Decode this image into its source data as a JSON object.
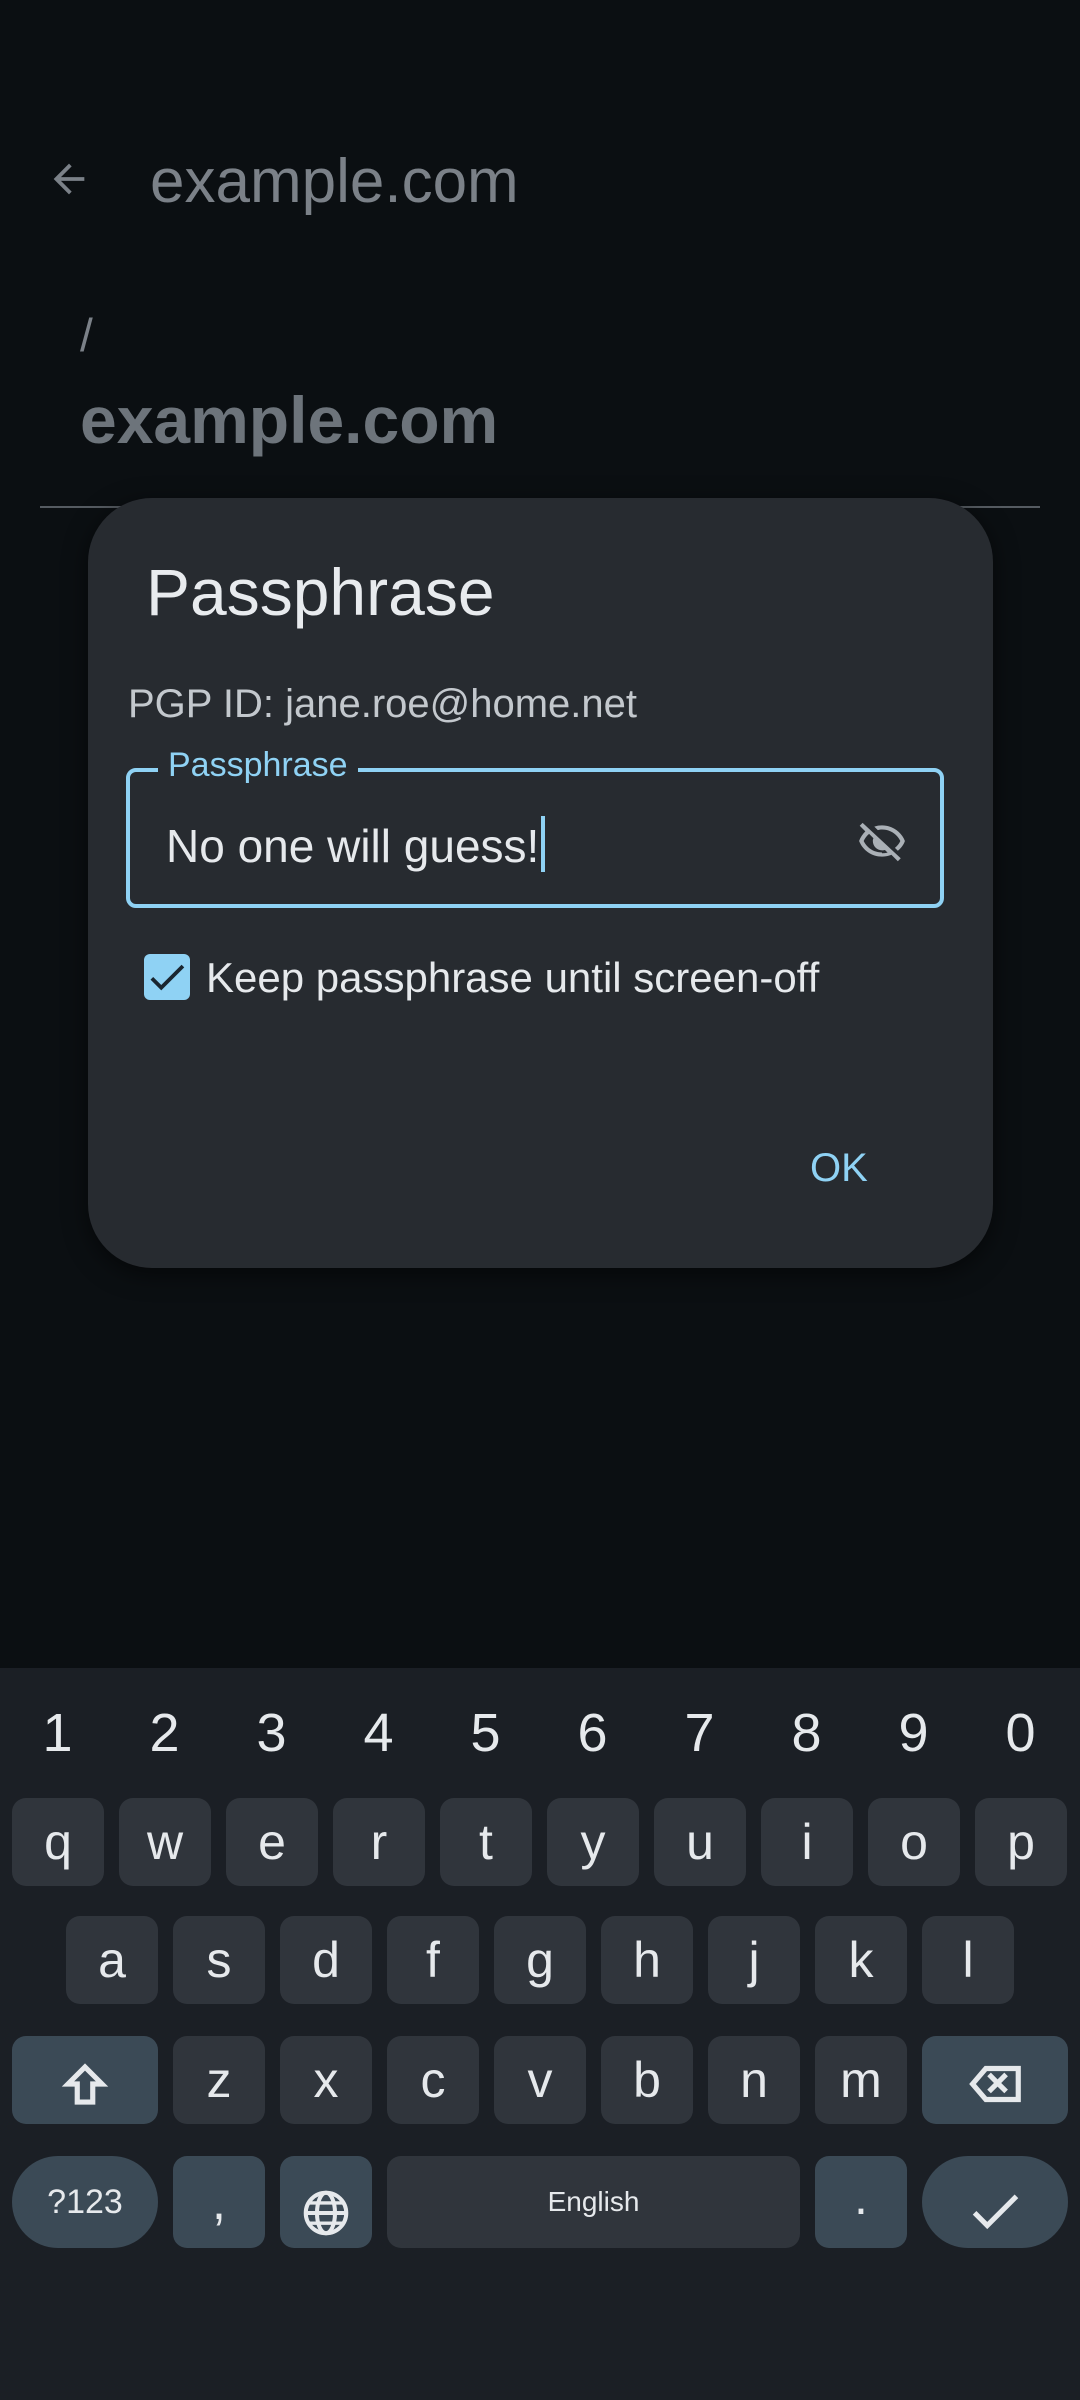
{
  "app": {
    "title": "example.com"
  },
  "path": {
    "slash": "/",
    "name": "example.com"
  },
  "dialog": {
    "title": "Passphrase",
    "pgp_id": "PGP ID: jane.roe@home.net",
    "field_label": "Passphrase",
    "field_value": "No one will guess!",
    "checkbox_label": "Keep passphrase until screen-off",
    "checkbox_checked": true,
    "ok_label": "OK"
  },
  "keyboard": {
    "numbers": [
      "1",
      "2",
      "3",
      "4",
      "5",
      "6",
      "7",
      "8",
      "9",
      "0"
    ],
    "row1": [
      "q",
      "w",
      "e",
      "r",
      "t",
      "y",
      "u",
      "i",
      "o",
      "p"
    ],
    "row2": [
      "a",
      "s",
      "d",
      "f",
      "g",
      "h",
      "j",
      "k",
      "l"
    ],
    "row3": [
      "z",
      "x",
      "c",
      "v",
      "b",
      "n",
      "m"
    ],
    "symbols_label": "?123",
    "comma_label": ",",
    "space_label": "English",
    "period_label": "."
  },
  "colors": {
    "accent": "#8fd2f4",
    "dialog_bg": "#272b30",
    "key_bg": "#30353c",
    "func_key_bg": "#3b4a56"
  }
}
